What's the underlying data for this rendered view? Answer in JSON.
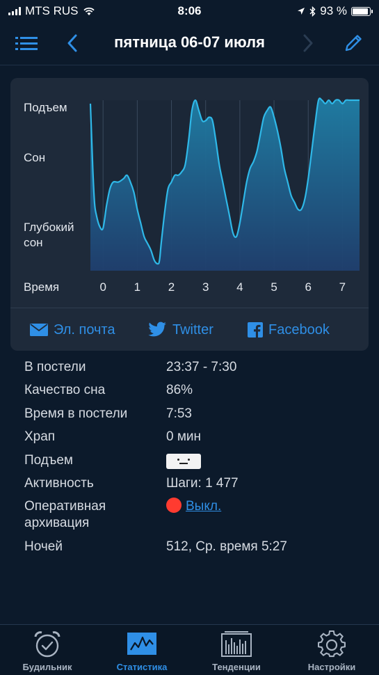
{
  "status_bar": {
    "carrier": "MTS RUS",
    "time": "8:06",
    "battery": "93 %",
    "battery_level": 0.93
  },
  "nav": {
    "title": "пятница 06-07 июля",
    "icons": [
      "list-icon",
      "chevron-left-icon",
      "chevron-right-icon",
      "pencil-icon"
    ]
  },
  "chart_data": {
    "type": "area",
    "y_labels": [
      "Подъем",
      "Сон",
      "Глубокий сон"
    ],
    "xlabel": "Время",
    "x_ticks": [
      "0",
      "1",
      "2",
      "3",
      "4",
      "5",
      "6",
      "7"
    ],
    "xlim": [
      -0.37,
      7.5
    ],
    "ylim": [
      0,
      100
    ],
    "grid": true,
    "color": "#2fb8e8",
    "series": [
      {
        "x": [
          -0.37,
          -0.3,
          -0.25,
          -0.2,
          -0.1,
          0.0,
          0.1,
          0.2,
          0.3,
          0.45,
          0.6,
          0.7,
          0.8,
          0.9,
          1.0,
          1.1,
          1.2,
          1.3,
          1.4,
          1.5,
          1.6,
          1.65,
          1.7,
          1.8,
          1.9,
          2.0,
          2.1,
          2.2,
          2.3,
          2.4,
          2.5,
          2.6,
          2.7,
          2.8,
          2.9,
          3.0,
          3.1,
          3.2,
          3.3,
          3.4,
          3.5,
          3.6,
          3.7,
          3.8,
          3.9,
          4.0,
          4.1,
          4.2,
          4.3,
          4.4,
          4.5,
          4.6,
          4.7,
          4.8,
          4.9,
          5.0,
          5.1,
          5.2,
          5.3,
          5.4,
          5.5,
          5.6,
          5.7,
          5.8,
          5.9,
          6.0,
          6.1,
          6.2,
          6.3,
          6.4,
          6.5,
          6.6,
          6.7,
          6.8,
          6.9,
          7.0,
          7.1,
          7.2,
          7.3,
          7.4,
          7.5
        ],
        "y": [
          98,
          60,
          40,
          33,
          26,
          25,
          38,
          48,
          52,
          52,
          54,
          56,
          52,
          46,
          36,
          28,
          20,
          16,
          12,
          6,
          4,
          6,
          16,
          34,
          48,
          52,
          56,
          56,
          58,
          62,
          76,
          94,
          100,
          94,
          88,
          88,
          90,
          88,
          76,
          62,
          52,
          42,
          32,
          22,
          20,
          28,
          40,
          52,
          60,
          64,
          70,
          80,
          90,
          94,
          96,
          90,
          82,
          72,
          60,
          52,
          44,
          40,
          36,
          36,
          42,
          54,
          70,
          86,
          100,
          100,
          98,
          100,
          98,
          100,
          100,
          98,
          100,
          100,
          100,
          100,
          100
        ]
      }
    ]
  },
  "share": {
    "email": "Эл. почта",
    "twitter": "Twitter",
    "facebook": "Facebook"
  },
  "stats": {
    "in_bed_label": "В постели",
    "in_bed_value": "23:37 - 7:30",
    "quality_label": "Качество сна",
    "quality_value": "86%",
    "time_in_bed_label": "Время в постели",
    "time_in_bed_value": "7:53",
    "snore_label": "Храп",
    "snore_value": "0 мин",
    "wakeup_label": "Подъем",
    "activity_label": "Активность",
    "activity_value": "Шаги: 1 477",
    "backup_label_1": "Оперативная",
    "backup_label_2": "архивация",
    "backup_value": "Выкл.",
    "nights_label": "Ночей",
    "nights_value": "512, Ср. время 5:27"
  },
  "tabs": [
    {
      "label": "Будильник",
      "icon": "alarm-clock-icon"
    },
    {
      "label": "Статистика",
      "icon": "statistics-icon"
    },
    {
      "label": "Тенденции",
      "icon": "trends-icon"
    },
    {
      "label": "Настройки",
      "icon": "settings-gear-icon"
    }
  ],
  "colors": {
    "accent": "#2f8fe6",
    "background": "#0c1a2b",
    "card": "#1e2a3a",
    "chart_line": "#2fb8e8",
    "off_dot": "#ff3b30"
  }
}
